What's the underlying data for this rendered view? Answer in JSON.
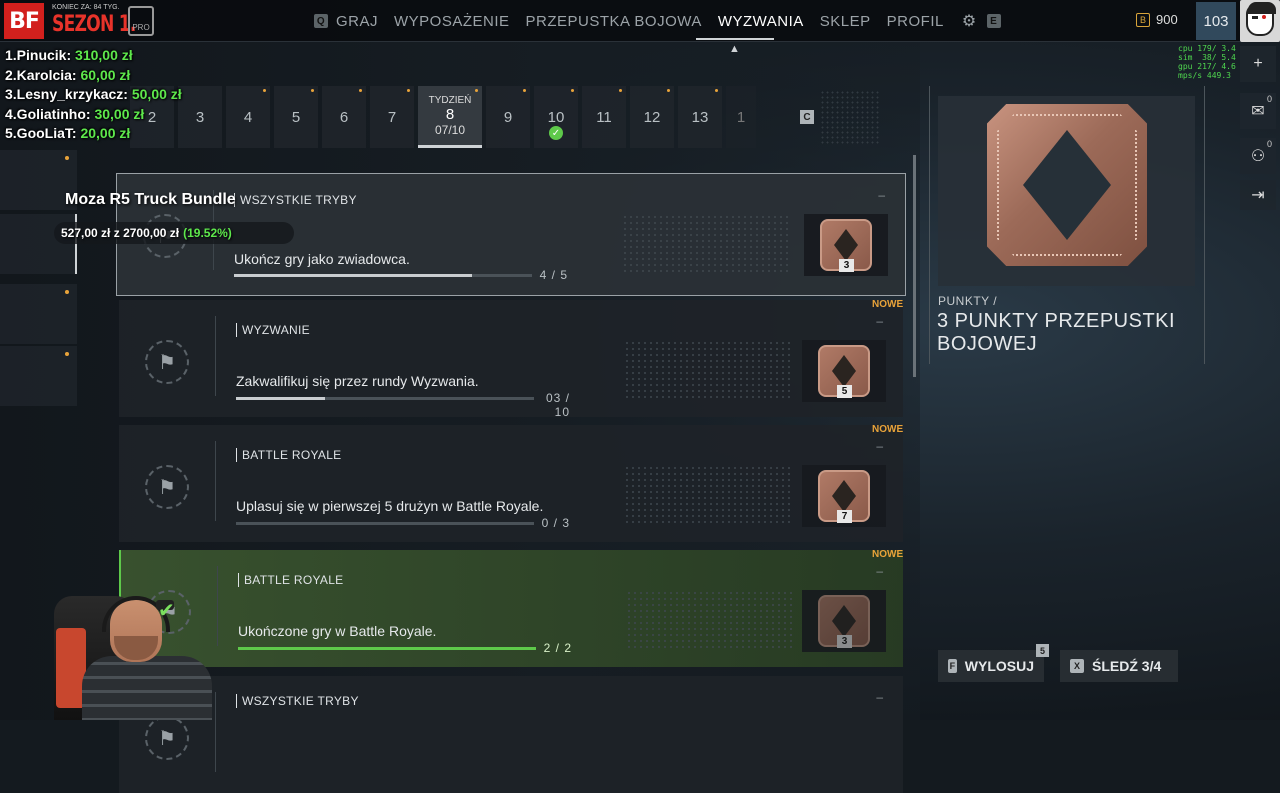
{
  "brand": {
    "logo": "BF",
    "season_small": "KONIEC ZA: 84 TYG.",
    "season": "SEZON 1.",
    "pro": "PRO"
  },
  "nav": {
    "left_key": "Q",
    "items": [
      {
        "label": "GRAJ",
        "dot": false
      },
      {
        "label": "WYPOSAŻENIE",
        "dot": true
      },
      {
        "label": "PRZEPUSTKA BOJOWA",
        "dot": false
      },
      {
        "label": "WYZWANIA",
        "dot": true,
        "active": true
      },
      {
        "label": "SKLEP",
        "dot": false
      },
      {
        "label": "PROFIL",
        "dot": false
      }
    ],
    "right_key": "E",
    "gear_icon": "gear-icon"
  },
  "currency": {
    "icon": "B",
    "amount": "900"
  },
  "level": "103",
  "perf_stats": "cpu 179/ 3.4\nsim  38/ 5.4\ngpu 217/ 4.6\nmps/s 449.3",
  "side_icons": [
    {
      "name": "plus-icon",
      "glyph": "+",
      "count": ""
    },
    {
      "name": "mail-icon",
      "glyph": "✉",
      "count": "0"
    },
    {
      "name": "squad-icon",
      "glyph": "⚇",
      "count": "0"
    },
    {
      "name": "exit-icon",
      "glyph": "⇥",
      "count": ""
    }
  ],
  "leaderboard": [
    {
      "name": "1.Pinucik: ",
      "amount": "310,00 zł"
    },
    {
      "name": "2.Karolcia: ",
      "amount": "60,00 zł"
    },
    {
      "name": "3.Lesny_krzykacz: ",
      "amount": "50,00 zł"
    },
    {
      "name": "4.Goliatinho: ",
      "amount": "30,00 zł"
    },
    {
      "name": "5.GooLiaT: ",
      "amount": "20,00 zł"
    }
  ],
  "donation": {
    "title": "Moza R5 Truck Bundle",
    "current": "527,00 zł",
    "sep": "z",
    "goal": "2700,00 zł",
    "pct": "(19.52%)"
  },
  "weeks": {
    "items": [
      "2",
      "3",
      "4",
      "5",
      "6",
      "7"
    ],
    "selected": {
      "label": "TYDZIEŃ",
      "num": "8",
      "progress": "07/10"
    },
    "after": [
      "9",
      "10",
      "11",
      "12",
      "13"
    ],
    "completed_week": "10",
    "key": "C",
    "faded": "1"
  },
  "challenges": [
    {
      "category": "WSZYSTKIE TRYBY",
      "desc": "Ukończ gry jako zwiadowca.",
      "progress_text": "4 / 5",
      "fill": 0.8,
      "reward": "3",
      "new": false,
      "done": false
    },
    {
      "category": "WYZWANIE",
      "desc": "Zakwalifikuj się przez rundy Wyzwania.",
      "progress_text": "03 / 10",
      "fill": 0.3,
      "reward": "5",
      "new": true,
      "done": false
    },
    {
      "category": "BATTLE ROYALE",
      "desc": "Uplasuj się w pierwszej 5 drużyn w Battle Royale.",
      "progress_text": "0 / 3",
      "fill": 0.0,
      "reward": "7",
      "new": true,
      "done": false
    },
    {
      "category": "BATTLE ROYALE",
      "desc": "Ukończone gry w Battle Royale.",
      "progress_text": "2 / 2",
      "fill": 1.0,
      "reward": "3",
      "new": true,
      "done": true
    },
    {
      "category": "WSZYSTKIE TRYBY",
      "desc": "",
      "progress_text": "",
      "fill": 0,
      "reward": "",
      "new": false,
      "done": false
    }
  ],
  "new_label": "NOWE",
  "detail": {
    "label": "PUNKTY /",
    "title": "3 PUNKTY PRZEPUSTKI BOJOWEJ"
  },
  "buttons": {
    "reroll": {
      "key": "F",
      "label": "WYLOSUJ",
      "count": "5"
    },
    "track": {
      "key": "X",
      "label": "ŚLEDŹ 3/4"
    }
  }
}
